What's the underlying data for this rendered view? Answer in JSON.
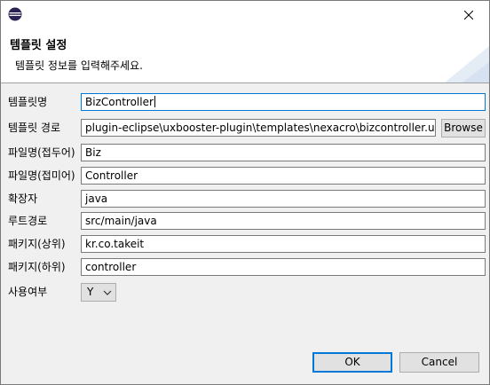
{
  "header": {
    "title": "템플릿 설정",
    "message": "템플릿 정보를 입력해주세요."
  },
  "form": {
    "fields": [
      {
        "label": "템플릿명",
        "value": "BizController"
      },
      {
        "label": "템플릿 경로",
        "value": "plugin-eclipse\\uxbooster-plugin\\templates\\nexacro\\bizcontroller.uxbt"
      },
      {
        "label": "파일명(접두어)",
        "value": "Biz"
      },
      {
        "label": "파일명(접미어)",
        "value": "Controller"
      },
      {
        "label": "확장자",
        "value": "java"
      },
      {
        "label": "루트경로",
        "value": "src/main/java"
      },
      {
        "label": "패키지(상위)",
        "value": "kr.co.takeit"
      },
      {
        "label": "패키지(하위)",
        "value": "controller"
      }
    ],
    "browse_label": "Browse",
    "use_label": "사용여부",
    "use_value": "Y"
  },
  "buttons": {
    "ok": "OK",
    "cancel": "Cancel"
  },
  "colors": {
    "accent": "#0078d7",
    "header_bg": "#ffffff",
    "dialog_bg": "#f0f0f0"
  },
  "icons": {
    "app": "eclipse-icon",
    "close": "close-icon",
    "dropdown": "chevron-down-icon"
  }
}
